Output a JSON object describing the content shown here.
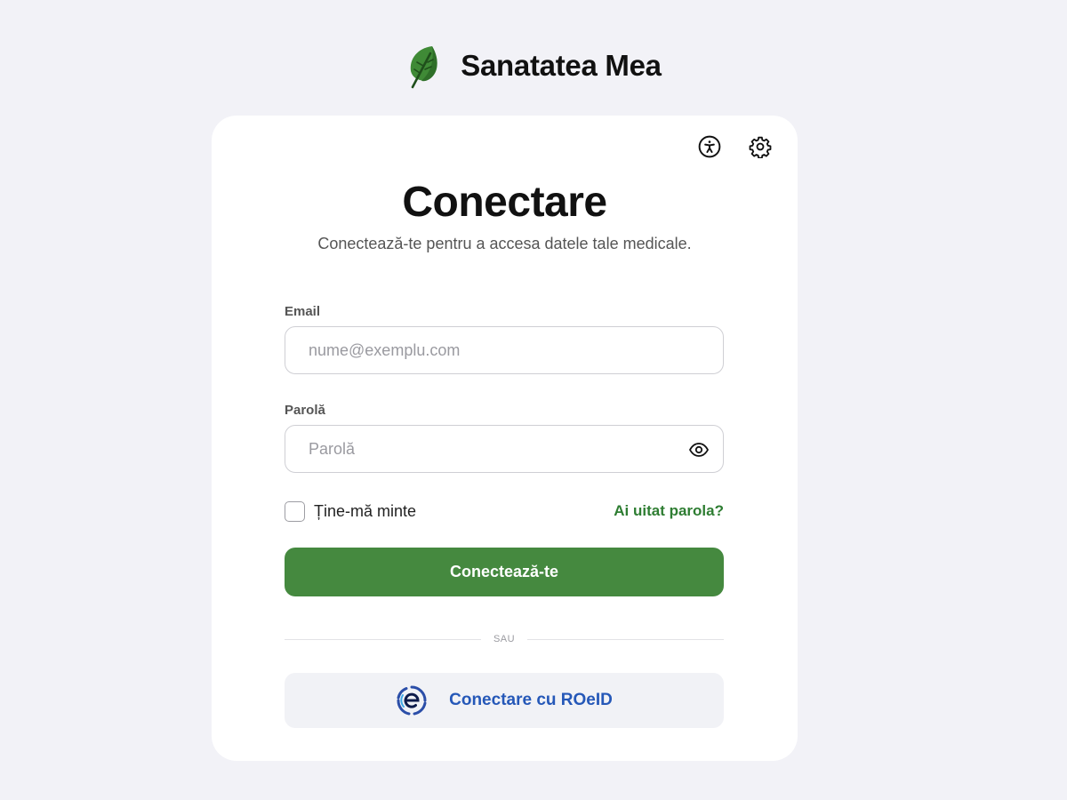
{
  "brand": {
    "name": "Sanatatea Mea",
    "logo_icon": "leaf-icon"
  },
  "card": {
    "accessibility_icon": "accessibility-icon",
    "settings_icon": "gear-icon",
    "title": "Conectare",
    "subtitle": "Conectează-te pentru a accesa datele tale medicale."
  },
  "form": {
    "email_label": "Email",
    "email_placeholder": "nume@exemplu.com",
    "email_value": "",
    "password_label": "Parolă",
    "password_placeholder": "Parolă",
    "password_value": "",
    "show_password_icon": "eye-icon",
    "remember_label": "Ține-mă minte",
    "remember_checked": false,
    "forgot_label": "Ai uitat parola?",
    "submit_label": "Conectează-te",
    "divider_label": "SAU",
    "roeid_label": "Conectare cu ROeID",
    "roeid_icon": "roeid-logo-icon"
  },
  "colors": {
    "accent_green": "#45893f",
    "link_green": "#2e7d32",
    "roeid_blue": "#2558b8",
    "background": "#f2f2f7"
  }
}
